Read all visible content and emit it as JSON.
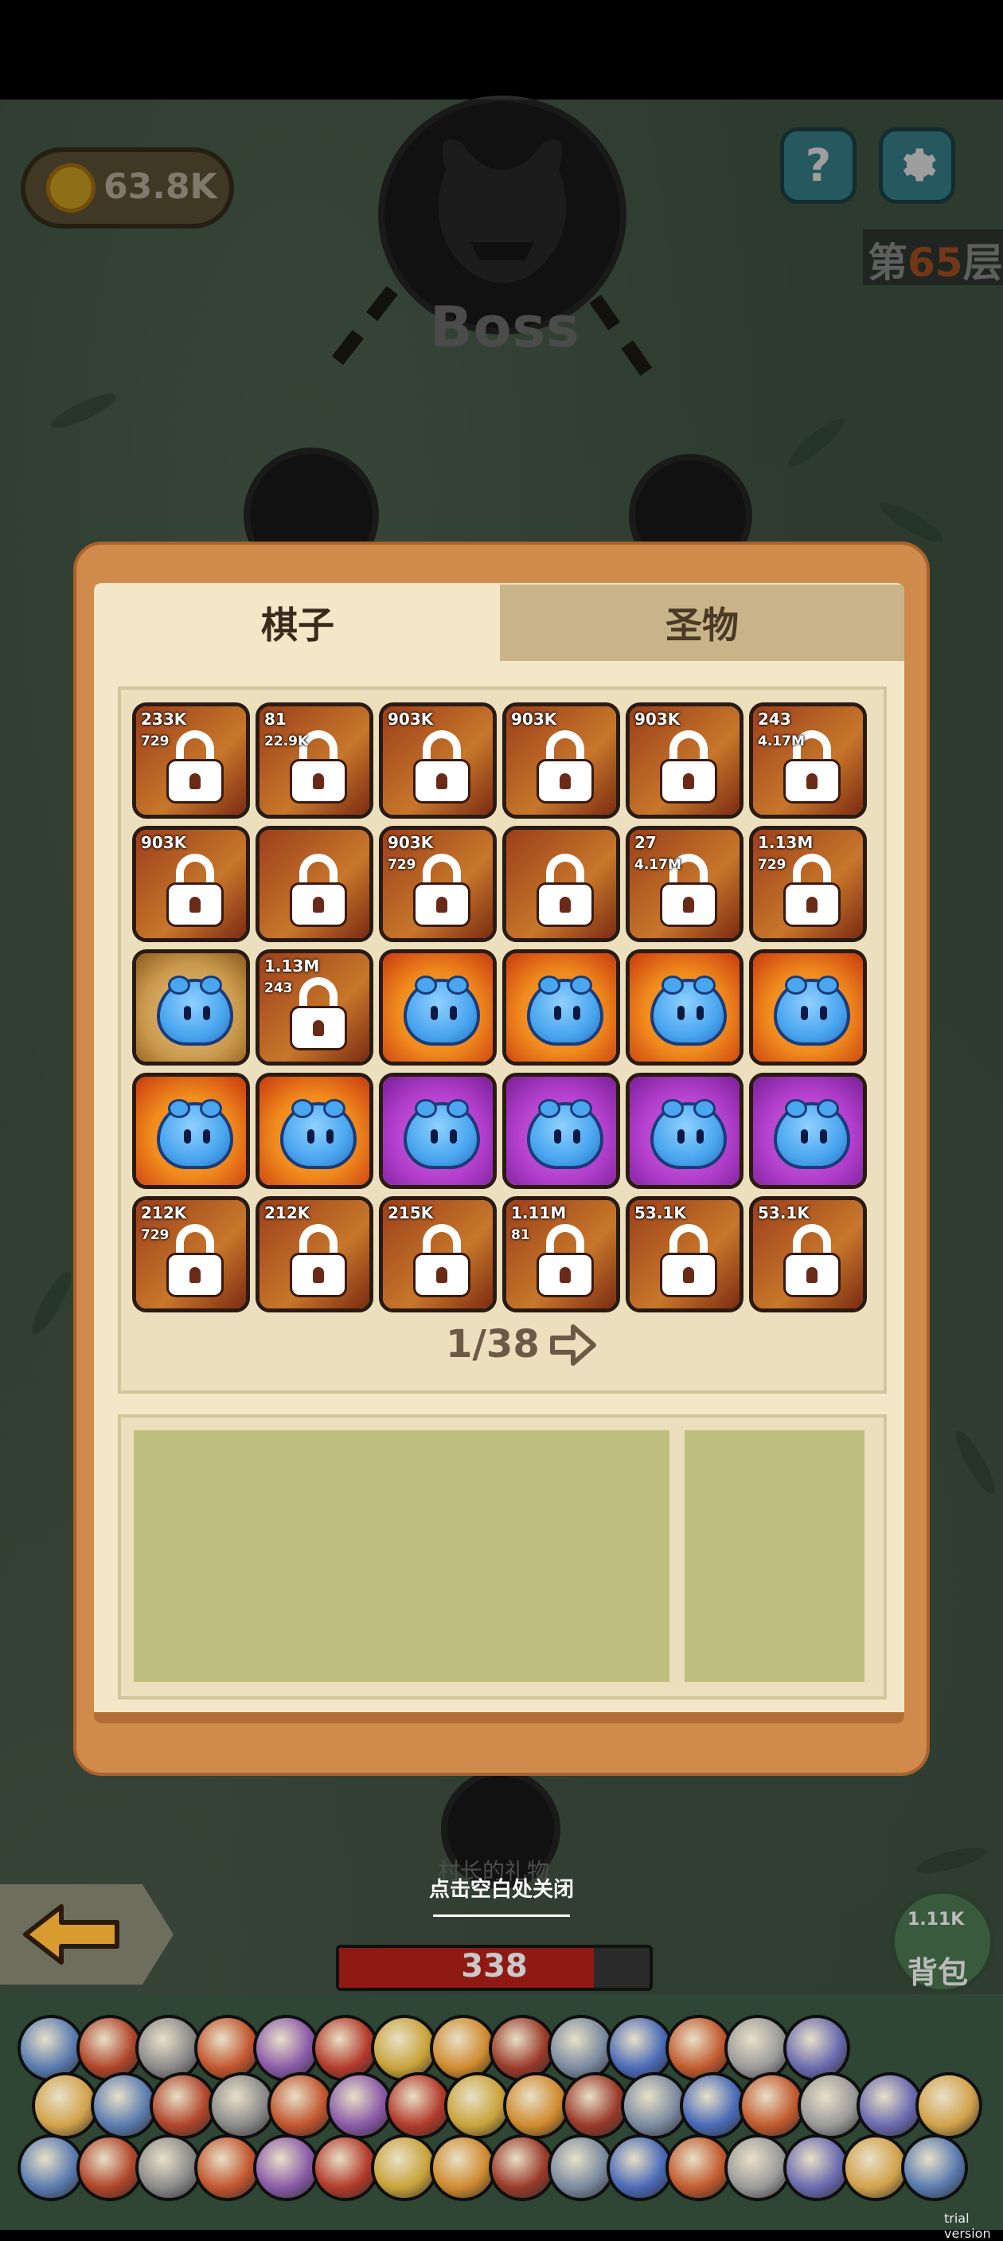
{
  "hud": {
    "coins": "63.8K",
    "help_glyph": "?",
    "floor_prefix": "第",
    "floor_number": "65",
    "floor_suffix": "层",
    "boss_label": "Boss",
    "icons": [
      "coin-icon",
      "help-icon",
      "gear-icon",
      "demon-icon"
    ]
  },
  "panel": {
    "tabs": [
      {
        "label": "棋子",
        "active": true
      },
      {
        "label": "圣物",
        "active": false
      }
    ],
    "page_indicator": "1/38",
    "grid": [
      [
        {
          "kind": "locked",
          "stat": "233K",
          "stat2": "729"
        },
        {
          "kind": "locked",
          "stat": "81",
          "stat2": "22.9K"
        },
        {
          "kind": "locked",
          "stat": "903K",
          "stat2": ""
        },
        {
          "kind": "locked",
          "stat": "903K",
          "stat2": ""
        },
        {
          "kind": "locked",
          "stat": "903K",
          "stat2": ""
        },
        {
          "kind": "locked",
          "stat": "243",
          "stat2": "4.17M"
        }
      ],
      [
        {
          "kind": "locked",
          "stat": "903K",
          "stat2": ""
        },
        {
          "kind": "locked",
          "stat": "",
          "stat2": ""
        },
        {
          "kind": "locked",
          "stat": "903K",
          "stat2": "729"
        },
        {
          "kind": "locked",
          "stat": "",
          "stat2": ""
        },
        {
          "kind": "locked",
          "stat": "27",
          "stat2": "4.17M"
        },
        {
          "kind": "locked",
          "stat": "1.13M",
          "stat2": "729"
        }
      ],
      [
        {
          "kind": "slime-tan",
          "stat": "",
          "stat2": ""
        },
        {
          "kind": "locked",
          "stat": "1.13M",
          "stat2": "243"
        },
        {
          "kind": "slime-orange",
          "stat": "",
          "stat2": ""
        },
        {
          "kind": "slime-orange",
          "stat": "",
          "stat2": ""
        },
        {
          "kind": "slime-orange",
          "stat": "",
          "stat2": ""
        },
        {
          "kind": "slime-orange",
          "stat": "",
          "stat2": ""
        }
      ],
      [
        {
          "kind": "slime-orange",
          "stat": "",
          "stat2": ""
        },
        {
          "kind": "slime-orange",
          "stat": "",
          "stat2": ""
        },
        {
          "kind": "slime-purple",
          "stat": "",
          "stat2": ""
        },
        {
          "kind": "slime-purple",
          "stat": "",
          "stat2": ""
        },
        {
          "kind": "slime-purple",
          "stat": "",
          "stat2": ""
        },
        {
          "kind": "slime-purple",
          "stat": "",
          "stat2": ""
        }
      ],
      [
        {
          "kind": "locked",
          "stat": "212K",
          "stat2": "729"
        },
        {
          "kind": "locked",
          "stat": "212K",
          "stat2": ""
        },
        {
          "kind": "locked",
          "stat": "215K",
          "stat2": ""
        },
        {
          "kind": "locked",
          "stat": "1.11M",
          "stat2": "81"
        },
        {
          "kind": "locked",
          "stat": "53.1K",
          "stat2": ""
        },
        {
          "kind": "locked",
          "stat": "53.1K",
          "stat2": ""
        }
      ]
    ]
  },
  "bottom": {
    "close_hint": "点击空白处关闭",
    "node_caption": "村长的礼物",
    "hp_value": "338",
    "hp_fraction": 0.82,
    "bag_count": "1.11K",
    "bag_label": "背包",
    "watermark": "trial version"
  },
  "colors": {
    "panel_frame": "#d08a4c",
    "panel_bg": "#f4e7c8",
    "slot_green": "#bfbf7f",
    "accent_teal": "#3d8e99",
    "hp_red": "#8f1a14"
  }
}
